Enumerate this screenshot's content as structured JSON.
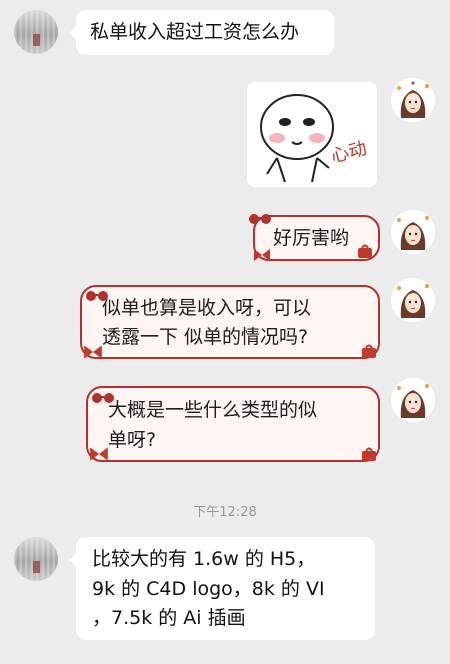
{
  "messages": [
    {
      "side": "left",
      "text": "私单收入超过工资怎么办"
    },
    {
      "side": "right",
      "type": "sticker",
      "sticker_text": "心动"
    },
    {
      "side": "right",
      "text": "好厉害哟"
    },
    {
      "side": "right",
      "lines": [
        "似单也算是收入呀，可以",
        "透露一下 似单的情况吗?"
      ]
    },
    {
      "side": "right",
      "lines": [
        "大概是一些什么类型的似",
        "单呀?"
      ]
    },
    {
      "side": "left",
      "lines": [
        "比较大的有 1.6w 的 H5，",
        "9k 的 C4D logo，8k 的 VI",
        "，7.5k 的 Ai 插画"
      ]
    }
  ],
  "timestamp": "下午12:28",
  "colors": {
    "bubble_border": "#b5302c",
    "bubble_fill": "#fff6f4",
    "background": "#ececec"
  }
}
